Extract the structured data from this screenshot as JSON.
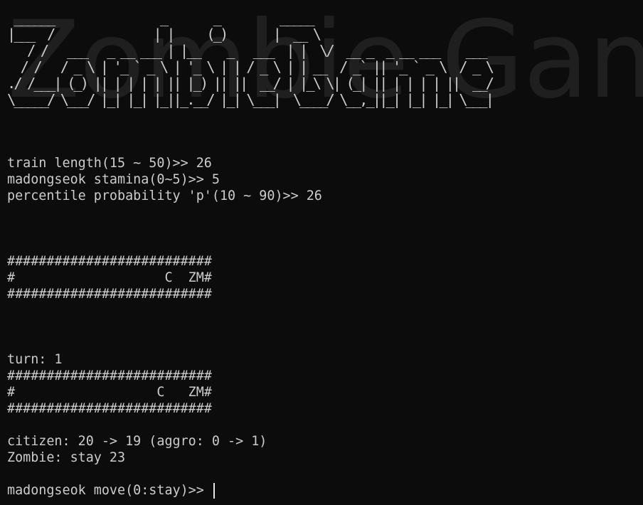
{
  "banner": {
    "title_text": "Zombie Game",
    "ascii_art": " ______                _       _         _____\n|___  /               | |     (_)       |  __ \\\n   / /   ___   _ __ ___ | |__    _   ___  | |  \\/  __ _  _ __ ___    ___\n  / /   / _ \\ | '_ ` _ \\ | '_ \\ | | / _ \\ | | __  / _` || '_ ` _ \\  / _ \\\n./ /___| (_) || | | | | || |_) || ||  __/ | |_\\ \\| (_| || | | | | ||  __/\n\\_____/ \\___/ |_| |_| |_||_.__/ |_| \\___|  \\____/ \\__,_||_| |_| |_| \\___|"
  },
  "setup": {
    "train_length": "train length(15 ~ 50)>> 26",
    "stamina": "madongseok stamina(0~5)>> 5",
    "probability": "percentile probability 'p'(10 ~ 90)>> 26"
  },
  "initial_train": {
    "top": "##########################",
    "middle": "#                   C  ZM#",
    "bottom": "##########################"
  },
  "turn": {
    "label": "turn: 1",
    "top": "##########################",
    "middle": "#                  C   ZM#",
    "bottom": "##########################"
  },
  "status": {
    "citizen": "citizen: 20 -> 19 (aggro: 0 -> 1)",
    "zombie": "Zombie: stay 23"
  },
  "prompt": {
    "text": "madongseok move(0:stay)>> "
  }
}
